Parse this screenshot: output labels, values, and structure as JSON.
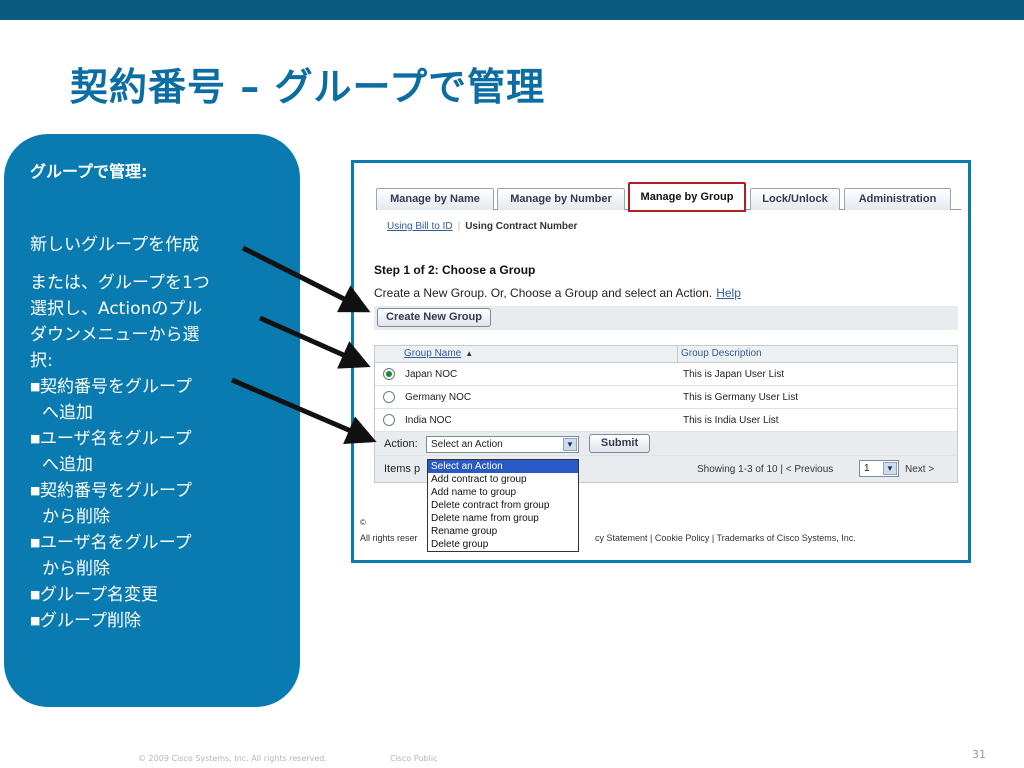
{
  "slide": {
    "title": "契約番号 – グループで管理",
    "page_number": "31",
    "footer_copyright": "© 2009 Cisco Systems, Inc. All rights reserved.",
    "footer_classification": "Cisco Public"
  },
  "panel": {
    "heading": "グループで管理:",
    "line1": "新しいグループを作成",
    "line2": [
      "または、グループを1つ",
      "選択し、Actionのプル",
      "ダウンメニューから選",
      "択:"
    ],
    "bullets": [
      [
        "契約番号をグループ",
        "へ追加"
      ],
      [
        "ユーザ名をグループ",
        "へ追加"
      ],
      [
        "契約番号をグループ",
        "から削除"
      ],
      [
        "ユーザ名をグループ",
        "から削除"
      ],
      [
        "グループ名変更"
      ],
      [
        "グループ削除"
      ]
    ]
  },
  "screenshot": {
    "tabs": [
      "Manage by Name",
      "Manage by Number",
      "Manage by Group",
      "Lock/Unlock",
      "Administration"
    ],
    "active_tab": "Manage by Group",
    "subnav": {
      "link": "Using Bill to ID",
      "current": "Using Contract Number"
    },
    "step_title": "Step 1 of 2: Choose a Group",
    "step_desc": "Create a New Group. Or, Choose a Group and select an Action.",
    "help_link": "Help",
    "create_button": "Create New Group",
    "columns": [
      "Group Name",
      "Group Description"
    ],
    "rows": [
      {
        "name": "Japan NOC",
        "desc": "This is Japan User List",
        "selected": true
      },
      {
        "name": "Germany NOC",
        "desc": "This is Germany User List",
        "selected": false
      },
      {
        "name": "India NOC",
        "desc": "This is India User List",
        "selected": false
      }
    ],
    "action_label": "Action:",
    "action_select_value": "Select an Action",
    "submit_button": "Submit",
    "items_label": "Items p",
    "showing_text": "Showing 1-3 of 10  | <  Previous",
    "page_value": "1",
    "next_text": "Next  >",
    "footer_copy": "©",
    "footer_rights": "All rights reser",
    "footer_links": "cy Statement | Cookie Policy | Trademarks of Cisco Systems, Inc.",
    "dropdown_options": [
      "Select an Action",
      "Add contract to group",
      "Add name to group",
      "Delete contract from group",
      "Delete name from group",
      "Rename group",
      "Delete group"
    ]
  },
  "colors": {
    "brand_blue": "#0b6da1",
    "panel_blue": "#0a7bb0",
    "active_tab_border": "#b01d22"
  }
}
